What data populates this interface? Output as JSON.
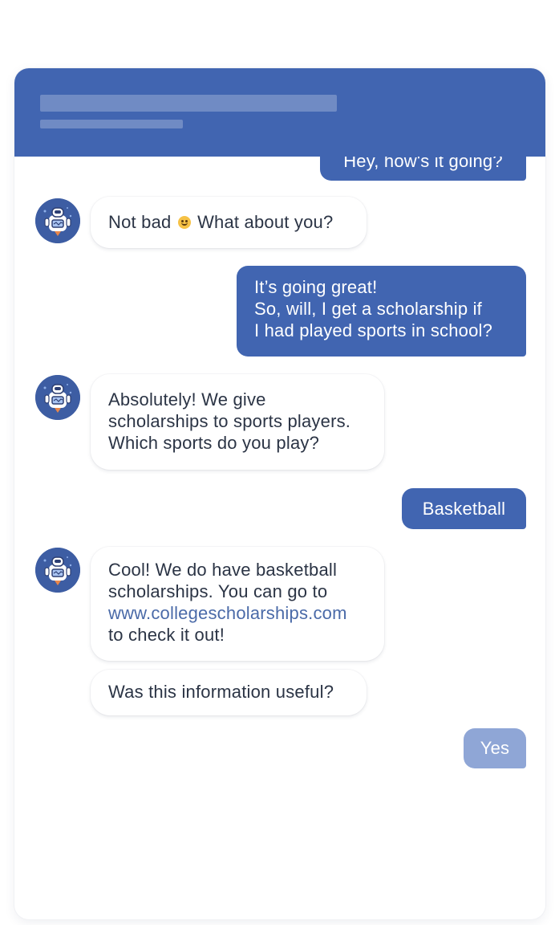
{
  "header": {
    "title_placeholder": "",
    "subtitle_placeholder": ""
  },
  "messages": {
    "m0": "Hey, how's it going?",
    "m1_before": "Not bad",
    "m1_after": "What about you?",
    "m1_emoji": "smiling-face-icon",
    "m2": [
      "It’s going great!",
      "So, will, I get a scholarship if",
      "I had played sports in school?"
    ],
    "m3": [
      "Absolutely! We give",
      "scholarships to sports players.",
      "Which sports do you play?"
    ],
    "m4": "Basketball",
    "m5": [
      "Cool! We do have basketball",
      "scholarships. You can go to",
      "www.collegescholarships.com",
      "to check it out!"
    ],
    "m6": "Was this information useful?",
    "m7": "Yes"
  },
  "avatar": {
    "icon": "robot-icon",
    "background_color": "#3d5da3"
  },
  "colors": {
    "accent": "#4165b1",
    "accent_faded": "#8fa6d6",
    "link": "#4a6aa8",
    "bot_text": "#2b3445"
  }
}
